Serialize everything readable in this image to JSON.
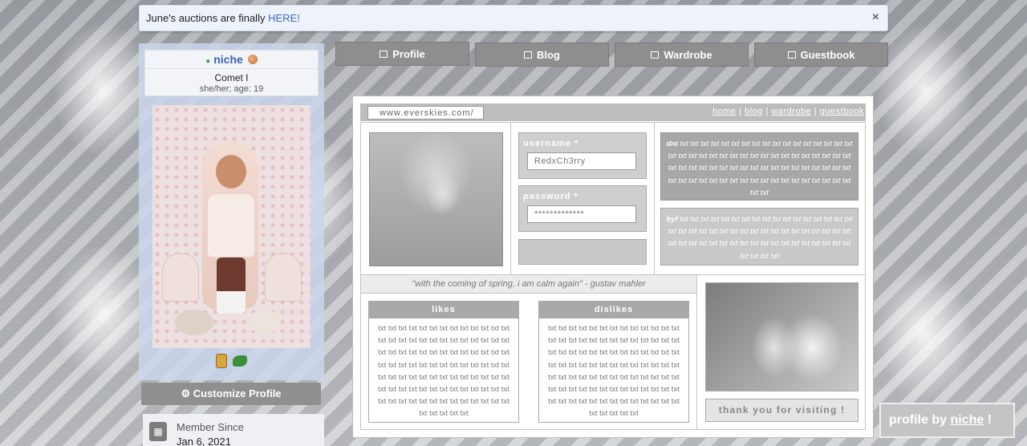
{
  "notice": {
    "text": "June's auctions are finally ",
    "link": "HERE!",
    "close": "×"
  },
  "user": {
    "name": "niche",
    "title": "Comet I",
    "pronouns": "she/her; age: 19"
  },
  "sidebar": {
    "customize_label": "Customize Profile",
    "member_since_label": "Member Since",
    "member_since_date": "Jan 6, 2021"
  },
  "tabs": [
    {
      "label": "Profile",
      "icon": "profile-card-icon"
    },
    {
      "label": "Blog",
      "icon": "blog-icon"
    },
    {
      "label": "Wardrobe",
      "icon": "wardrobe-icon"
    },
    {
      "label": "Guestbook",
      "icon": "guestbook-icon"
    }
  ],
  "profile": {
    "url": "www.everskies.com/",
    "nav": {
      "home": "home",
      "blog": "blog",
      "wardrobe": "wardrobe",
      "guestbook": "guestbook",
      "sep": "|"
    },
    "username_label": "username *",
    "username_value": "RedxCh3rry",
    "password_label": "password *",
    "password_value": "*************",
    "dni_label": "dni",
    "dni_text": "txt txt txt txt txt txt txt txt txt txt txt txt txt txt txt txt txt txt txt txt txt txt txt txt txt txt txt txt txt txt txt txt txt txt txt txt txt txt txt txt txt txt txt txt txt txt txt txt txt txt txt txt txt txt txt txt txt txt txt txt txt txt txt txt txt txt txt txt txt txt txt txt txt",
    "byf_label": "byf",
    "byf_text": "txt txt txt txt txt txt txt txt txt txt txt txt txt txt txt txt txt txt txt txt txt txt txt txt txt txt txt txt txt txt txt txt txt txt txt txt txt txt txt txt txt txt txt txt txt txt txt txt txt txt txt txt txt txt txt txt txt",
    "quote": "\"with the coming of spring, i am calm again\" - gustav mahler",
    "likes_label": "likes",
    "likes_text": "txt txt txt txt txt txt txt txt txt txt txt txt txt txt txt txt txt txt txt txt txt txt txt txt txt txt txt txt txt txt txt txt txt txt txt txt txt txt txt txt txt txt txt txt txt txt txt txt txt txt txt txt txt txt txt txt txt txt txt txt txt txt txt txt txt txt txt txt txt txt txt txt txt txt txt txt txt txt txt txt txt txt txt txt txt txt txt txt txt txt txt txt txt txt txt txt",
    "dislikes_label": "dislikes",
    "dislikes_text": "txt txt txt txt txt txt txt txt txt txt txt txt txt txt txt txt txt txt txt txt txt txt txt txt txt txt txt txt txt txt txt txt txt txt txt txt txt txt txt txt txt txt txt txt txt txt txt txt txt txt txt txt txt txt txt txt txt txt txt txt txt txt txt txt txt txt txt txt txt txt txt txt txt txt txt txt txt txt txt txt txt txt txt txt txt txt txt txt txt txt txt txt txt txt txt txt",
    "thanks": "thank you for visiting !"
  },
  "credit": {
    "prefix": "profile by ",
    "name": "niche",
    "suffix": " !"
  },
  "colors": {
    "accent": "#3d64b2",
    "tab": "#8e8e8e",
    "panel_gray": "#a9a9a9"
  }
}
